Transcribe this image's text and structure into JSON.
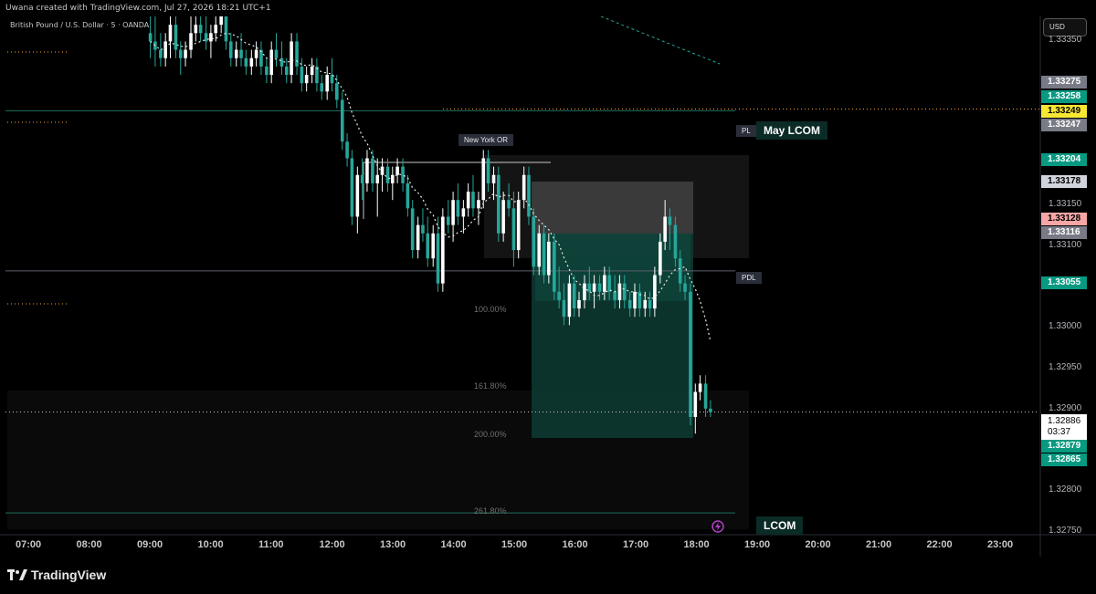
{
  "header": {
    "created_text": "Uwana created with TradingView.com, Jul 27, 2026 18:21 UTC+1",
    "symbol_text": "British Pound / U.S. Dollar · 5 · OANDA",
    "currency_button": "USD"
  },
  "colors": {
    "up": "#ffffff",
    "down": "#26a69a",
    "background": "#000000",
    "box_green": "#0e3b34",
    "box_grey": "#3a3a3a"
  },
  "price_axis": {
    "ticks": [
      "1.33350",
      "1.33150",
      "1.33100",
      "1.33000",
      "1.32950",
      "1.32900",
      "1.32800",
      "1.32750"
    ],
    "badges": [
      {
        "text": "1.33275",
        "bg": "#787b86",
        "fg": "#ffffff"
      },
      {
        "text": "1.33258",
        "bg": "#089981",
        "fg": "#ffffff"
      },
      {
        "text": "1.33249",
        "bg": "#f7e733",
        "fg": "#000000"
      },
      {
        "text": "1.33247",
        "bg": "#787b86",
        "fg": "#ffffff"
      },
      {
        "text": "1.33204",
        "bg": "#089981",
        "fg": "#ffffff"
      },
      {
        "text": "1.33178",
        "bg": "#d1d4dc",
        "fg": "#000000"
      },
      {
        "text": "1.33128",
        "bg": "#f7a5a5",
        "fg": "#000000"
      },
      {
        "text": "1.33116",
        "bg": "#787b86",
        "fg": "#ffffff"
      },
      {
        "text": "1.33055",
        "bg": "#089981",
        "fg": "#ffffff"
      },
      {
        "text": "1.32879",
        "bg": "#089981",
        "fg": "#ffffff"
      },
      {
        "text": "1.32865",
        "bg": "#089981",
        "fg": "#ffffff"
      }
    ],
    "last_price": "1.32886",
    "countdown": "03:37"
  },
  "time_axis": [
    "07:00",
    "08:00",
    "09:00",
    "10:00",
    "11:00",
    "12:00",
    "13:00",
    "14:00",
    "15:00",
    "16:00",
    "17:00",
    "18:00",
    "19:00",
    "20:00",
    "21:00",
    "22:00",
    "23:00"
  ],
  "annotations": {
    "new_york_or": "New York OR",
    "pdl": "PDL",
    "pl": "PL",
    "may_lcom": "May LCOM",
    "lcom": "LCOM",
    "fib_100": "100.00%",
    "fib_161": "161.80%",
    "fib_200": "200.00%",
    "fib_261": "261.80%"
  },
  "footer": {
    "brand": "TradingView"
  },
  "chart_data": {
    "type": "candlestick",
    "title": "British Pound / U.S. Dollar · 5 · OANDA",
    "xlabel": "",
    "ylabel": "",
    "ylim": [
      1.3274,
      1.3336
    ],
    "levels": [
      {
        "name": "May LCOM",
        "value": 1.33247
      },
      {
        "name": "PDL",
        "value": 1.33055
      },
      {
        "name": "LCOM",
        "value": 1.32765
      }
    ],
    "last": 1.32886,
    "candles": [
      [
        9.0,
        1.3334,
        1.3336,
        1.3331,
        1.3333
      ],
      [
        9.08,
        1.3333,
        1.3336,
        1.333,
        1.3332
      ],
      [
        9.17,
        1.3332,
        1.3334,
        1.333,
        1.3331
      ],
      [
        9.25,
        1.3331,
        1.3334,
        1.333,
        1.3333
      ],
      [
        9.33,
        1.3333,
        1.3336,
        1.3331,
        1.3335
      ],
      [
        9.42,
        1.3335,
        1.3336,
        1.3331,
        1.3332
      ],
      [
        9.5,
        1.3332,
        1.3333,
        1.3329,
        1.3331
      ],
      [
        9.58,
        1.3331,
        1.3333,
        1.333,
        1.3332
      ],
      [
        9.67,
        1.3332,
        1.3336,
        1.3331,
        1.3334
      ],
      [
        9.75,
        1.3334,
        1.3336,
        1.3333,
        1.3335
      ],
      [
        9.83,
        1.3335,
        1.3336,
        1.3333,
        1.3334
      ],
      [
        9.92,
        1.3334,
        1.3336,
        1.3332,
        1.3333
      ],
      [
        10.0,
        1.3333,
        1.3335,
        1.3331,
        1.3334
      ],
      [
        10.08,
        1.3334,
        1.3336,
        1.3333,
        1.3335
      ],
      [
        10.17,
        1.3335,
        1.3336,
        1.3334,
        1.3336
      ],
      [
        10.25,
        1.3336,
        1.3336,
        1.3332,
        1.3333
      ],
      [
        10.33,
        1.3333,
        1.3334,
        1.333,
        1.3331
      ],
      [
        10.42,
        1.3331,
        1.3333,
        1.333,
        1.3332
      ],
      [
        10.5,
        1.3332,
        1.3334,
        1.333,
        1.3331
      ],
      [
        10.58,
        1.3331,
        1.3332,
        1.3329,
        1.333
      ],
      [
        10.67,
        1.333,
        1.3332,
        1.3329,
        1.3331
      ],
      [
        10.75,
        1.3331,
        1.3333,
        1.333,
        1.3332
      ],
      [
        10.83,
        1.3332,
        1.3333,
        1.3329,
        1.333
      ],
      [
        10.92,
        1.333,
        1.3331,
        1.3328,
        1.3329
      ],
      [
        11.0,
        1.3329,
        1.3333,
        1.3328,
        1.3332
      ],
      [
        11.08,
        1.3332,
        1.3334,
        1.333,
        1.3331
      ],
      [
        11.17,
        1.3331,
        1.3333,
        1.3329,
        1.333
      ],
      [
        11.25,
        1.333,
        1.3331,
        1.3328,
        1.3329
      ],
      [
        11.33,
        1.3329,
        1.3334,
        1.3328,
        1.3333
      ],
      [
        11.42,
        1.3333,
        1.3334,
        1.3329,
        1.333
      ],
      [
        11.5,
        1.333,
        1.3331,
        1.3327,
        1.3328
      ],
      [
        11.58,
        1.3328,
        1.333,
        1.3327,
        1.3329
      ],
      [
        11.67,
        1.3329,
        1.3331,
        1.3328,
        1.333
      ],
      [
        11.75,
        1.333,
        1.3331,
        1.3327,
        1.3328
      ],
      [
        11.83,
        1.3328,
        1.3329,
        1.3326,
        1.3327
      ],
      [
        11.92,
        1.3327,
        1.333,
        1.3326,
        1.3329
      ],
      [
        12.0,
        1.3329,
        1.3331,
        1.3327,
        1.3328
      ],
      [
        12.08,
        1.3328,
        1.3329,
        1.3325,
        1.3326
      ],
      [
        12.17,
        1.3326,
        1.3327,
        1.332,
        1.3321
      ],
      [
        12.25,
        1.3321,
        1.3322,
        1.3318,
        1.3319
      ],
      [
        12.33,
        1.3319,
        1.332,
        1.3311,
        1.3312
      ],
      [
        12.42,
        1.3312,
        1.3318,
        1.331,
        1.3317
      ],
      [
        12.5,
        1.3317,
        1.3319,
        1.3314,
        1.3316
      ],
      [
        12.58,
        1.3316,
        1.332,
        1.3315,
        1.3319
      ],
      [
        12.67,
        1.3319,
        1.332,
        1.3315,
        1.3316
      ],
      [
        12.75,
        1.3316,
        1.3319,
        1.3312,
        1.3317
      ],
      [
        12.83,
        1.3317,
        1.3319,
        1.3315,
        1.3318
      ],
      [
        12.92,
        1.3318,
        1.3319,
        1.3315,
        1.3316
      ],
      [
        13.0,
        1.3316,
        1.3318,
        1.3314,
        1.3317
      ],
      [
        13.08,
        1.3317,
        1.3319,
        1.3316,
        1.3318
      ],
      [
        13.17,
        1.3318,
        1.3319,
        1.3315,
        1.3316
      ],
      [
        13.25,
        1.3316,
        1.3317,
        1.3312,
        1.3313
      ],
      [
        13.33,
        1.3313,
        1.3314,
        1.3307,
        1.3308
      ],
      [
        13.42,
        1.3308,
        1.3312,
        1.3307,
        1.3311
      ],
      [
        13.5,
        1.3311,
        1.3313,
        1.3309,
        1.331
      ],
      [
        13.58,
        1.331,
        1.3312,
        1.3306,
        1.3307
      ],
      [
        13.67,
        1.3307,
        1.3311,
        1.3306,
        1.331
      ],
      [
        13.75,
        1.331,
        1.3312,
        1.3303,
        1.3304
      ],
      [
        13.83,
        1.3304,
        1.3313,
        1.3303,
        1.3312
      ],
      [
        13.92,
        1.3312,
        1.3314,
        1.331,
        1.3311
      ],
      [
        14.0,
        1.3311,
        1.3315,
        1.3309,
        1.3314
      ],
      [
        14.08,
        1.3314,
        1.3316,
        1.3311,
        1.3312
      ],
      [
        14.17,
        1.3312,
        1.3314,
        1.331,
        1.3313
      ],
      [
        14.25,
        1.3313,
        1.3316,
        1.3312,
        1.3315
      ],
      [
        14.33,
        1.3315,
        1.3317,
        1.3312,
        1.3313
      ],
      [
        14.42,
        1.3313,
        1.3315,
        1.3311,
        1.3314
      ],
      [
        14.5,
        1.3314,
        1.332,
        1.3313,
        1.3319
      ],
      [
        14.58,
        1.3319,
        1.332,
        1.3315,
        1.3316
      ],
      [
        14.67,
        1.3316,
        1.3318,
        1.3314,
        1.3317
      ],
      [
        14.75,
        1.3317,
        1.3318,
        1.3309,
        1.331
      ],
      [
        14.83,
        1.331,
        1.3315,
        1.3309,
        1.3314
      ],
      [
        14.92,
        1.3314,
        1.3316,
        1.3312,
        1.3313
      ],
      [
        15.0,
        1.3313,
        1.3315,
        1.3306,
        1.3308
      ],
      [
        15.08,
        1.3308,
        1.3315,
        1.3307,
        1.3314
      ],
      [
        15.17,
        1.3314,
        1.3318,
        1.3313,
        1.3317
      ],
      [
        15.25,
        1.3317,
        1.3318,
        1.3311,
        1.3312
      ],
      [
        15.33,
        1.3312,
        1.3313,
        1.3305,
        1.3306
      ],
      [
        15.42,
        1.3306,
        1.3311,
        1.3305,
        1.331
      ],
      [
        15.5,
        1.331,
        1.3311,
        1.3304,
        1.3305
      ],
      [
        15.58,
        1.3305,
        1.331,
        1.3304,
        1.3309
      ],
      [
        15.67,
        1.3309,
        1.331,
        1.3302,
        1.3303
      ],
      [
        15.75,
        1.3303,
        1.3306,
        1.3301,
        1.3302
      ],
      [
        15.83,
        1.3302,
        1.3304,
        1.3299,
        1.33
      ],
      [
        15.92,
        1.33,
        1.3305,
        1.3299,
        1.3304
      ],
      [
        16.0,
        1.3304,
        1.3305,
        1.33,
        1.3301
      ],
      [
        16.08,
        1.3301,
        1.3303,
        1.33,
        1.3302
      ],
      [
        16.17,
        1.3302,
        1.3305,
        1.3301,
        1.3304
      ],
      [
        16.25,
        1.3304,
        1.3306,
        1.3302,
        1.3303
      ],
      [
        16.33,
        1.3303,
        1.3305,
        1.3301,
        1.3304
      ],
      [
        16.42,
        1.3304,
        1.3305,
        1.3302,
        1.3303
      ],
      [
        16.5,
        1.3303,
        1.3306,
        1.3302,
        1.3305
      ],
      [
        16.58,
        1.3305,
        1.3306,
        1.3302,
        1.3303
      ],
      [
        16.67,
        1.3303,
        1.3305,
        1.3301,
        1.3302
      ],
      [
        16.75,
        1.3302,
        1.3305,
        1.3301,
        1.3304
      ],
      [
        16.83,
        1.3304,
        1.3305,
        1.3301,
        1.3302
      ],
      [
        16.92,
        1.3302,
        1.3303,
        1.33,
        1.3301
      ],
      [
        17.0,
        1.3301,
        1.3304,
        1.33,
        1.3303
      ],
      [
        17.08,
        1.3303,
        1.3304,
        1.33,
        1.3301
      ],
      [
        17.17,
        1.3301,
        1.3303,
        1.33,
        1.3302
      ],
      [
        17.25,
        1.3302,
        1.3303,
        1.33,
        1.3301
      ],
      [
        17.33,
        1.3301,
        1.3306,
        1.33,
        1.3305
      ],
      [
        17.42,
        1.3305,
        1.331,
        1.3304,
        1.3309
      ],
      [
        17.5,
        1.3309,
        1.3314,
        1.3308,
        1.3312
      ],
      [
        17.58,
        1.3312,
        1.3313,
        1.3308,
        1.3311
      ],
      [
        17.67,
        1.3311,
        1.3312,
        1.3306,
        1.3307
      ],
      [
        17.75,
        1.3307,
        1.3308,
        1.3303,
        1.3304
      ],
      [
        17.83,
        1.3304,
        1.3305,
        1.3302,
        1.3303
      ],
      [
        17.92,
        1.3303,
        1.3304,
        1.3287,
        1.3288
      ],
      [
        18.0,
        1.3288,
        1.3292,
        1.3286,
        1.3291
      ],
      [
        18.08,
        1.3291,
        1.3293,
        1.329,
        1.3292
      ],
      [
        18.17,
        1.3292,
        1.3293,
        1.3288,
        1.3289
      ],
      [
        18.25,
        1.3289,
        1.329,
        1.3288,
        1.32886
      ]
    ]
  }
}
